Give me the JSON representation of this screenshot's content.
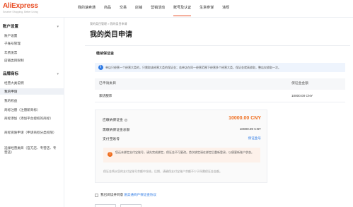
{
  "header": {
    "logo_brand": "AliExpress",
    "logo_slogan": "Smarter Shopping, Better Living",
    "nav": [
      "我的速卖通",
      "商品",
      "交易",
      "店铺",
      "营销活动",
      "账号及认证",
      "生意参谋",
      "违规"
    ],
    "active_nav_index": 5
  },
  "sidebar": {
    "groups": [
      {
        "title": "账户设置",
        "arrow": "▾",
        "items": [
          "账户设置",
          "子账号管理",
          "年费发票",
          "店铺类目限制"
        ]
      },
      {
        "title": "品牌商标",
        "arrow": "▾",
        "items": [
          "经营大类说明",
          "我的申请",
          "我的权益",
          "商标注册（注册新商标）",
          "商标添加（添加平台授权的商标）",
          "商标资质申请（申请商标分类权限）",
          "选择经营类目（官方店、专营店、专营店）"
        ]
      }
    ],
    "active_item": "我的申请"
  },
  "breadcrumb": "我的类目管理 > 我的类目申请",
  "page_title": "我的类目申请",
  "section_title": "缴纳保证金",
  "info_bar": {
    "icon": "i",
    "text": "单店只经营一个经营大类的，只需取该经营大类的保证金；若单店在同一经营范围下经营多个经营大类，保证金就高收取，整店仅收取一次。"
  },
  "table": {
    "headers": [
      "已申请类目",
      "保证金金额"
    ],
    "rows": [
      [
        "家纺服饰",
        "10000.00 CNY"
      ]
    ]
  },
  "payment": {
    "label_payable": "应缴纳保证金",
    "amount_payable": "10000.00 CNY",
    "label_frozen": "需缴纳保证金总额",
    "amount_frozen": "10000.00 CNY",
    "label_account": "支付宝账号",
    "account_link": "保证金号",
    "warning": "您还未绑定支付宝账号，请先完成绑定，保证金不可更改。首次绑定请在绑定后重新登录，以便更新账户状态。",
    "note": "保证金将从您的支付宝账号余额中冻结，后期，请确保支付宝账户余额不少于所需保证金金额。"
  },
  "agreement": {
    "text": "我已阅读并同意",
    "link": "速卖通商户保证金协议"
  },
  "colors": {
    "brand": "#e84c23",
    "accent_orange": "#ef6e1f",
    "link_blue": "#2f7be5"
  }
}
